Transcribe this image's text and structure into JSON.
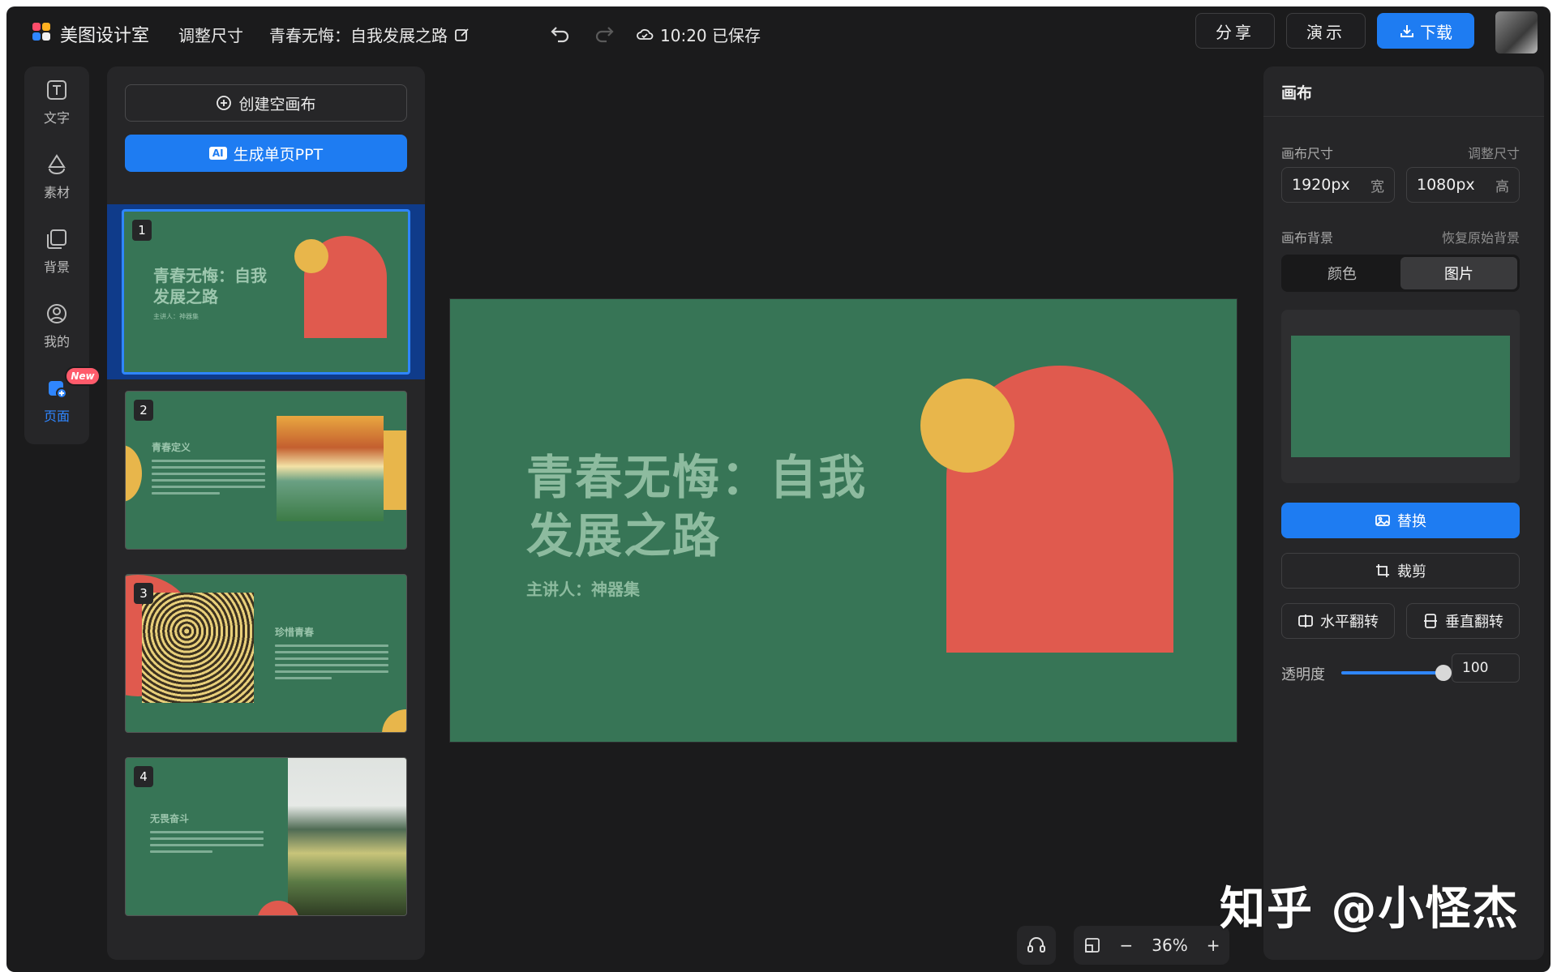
{
  "app": {
    "name": "美图设计室",
    "resize_menu": "调整尺寸",
    "doc_title": "青春无悔：自我发展之路",
    "save_status": "10:20 已保存"
  },
  "topbar": {
    "share_label": "分享",
    "present_label": "演示",
    "download_label": "下载"
  },
  "rail": {
    "items": [
      {
        "label": "文字",
        "icon": "text-icon"
      },
      {
        "label": "素材",
        "icon": "shapes-icon"
      },
      {
        "label": "背景",
        "icon": "background-icon"
      },
      {
        "label": "我的",
        "icon": "user-icon"
      },
      {
        "label": "页面",
        "icon": "pages-icon"
      }
    ],
    "new_badge": "New"
  },
  "pages_panel": {
    "create_blank_label": "创建空画布",
    "ai_tag": "AI",
    "ai_generate_label": "生成单页PPT",
    "thumbs": [
      {
        "num": "1",
        "title": "青春无悔：自我发展之路",
        "subtitle": "主讲人：神器集"
      },
      {
        "num": "2",
        "title": "青春定义"
      },
      {
        "num": "3",
        "title": "珍惜青春"
      },
      {
        "num": "4",
        "title": "无畏奋斗"
      }
    ]
  },
  "canvas": {
    "title_line1": "青春无悔：自我",
    "title_line2": "发展之路",
    "subtitle": "主讲人：神器集",
    "colors": {
      "bg": "#377556",
      "arch": "#e05a4e",
      "sun": "#e8b64b",
      "text": "#8dbb9f"
    }
  },
  "zoom": {
    "level": "36%",
    "minus": "−",
    "plus": "+"
  },
  "props": {
    "title": "画布",
    "size_label": "画布尺寸",
    "resize_link": "调整尺寸",
    "width_value": "1920px",
    "width_unit": "宽",
    "height_value": "1080px",
    "height_unit": "高",
    "bg_label": "画布背景",
    "restore_link": "恢复原始背景",
    "tab_color": "颜色",
    "tab_image": "图片",
    "replace_label": "替换",
    "crop_label": "裁剪",
    "flip_h_label": "水平翻转",
    "flip_v_label": "垂直翻转",
    "opacity_label": "透明度",
    "opacity_value": "100",
    "opacity_fraction": 1.0
  },
  "watermark": "知乎 @小怪杰",
  "accent_color": "#1e7cf2"
}
